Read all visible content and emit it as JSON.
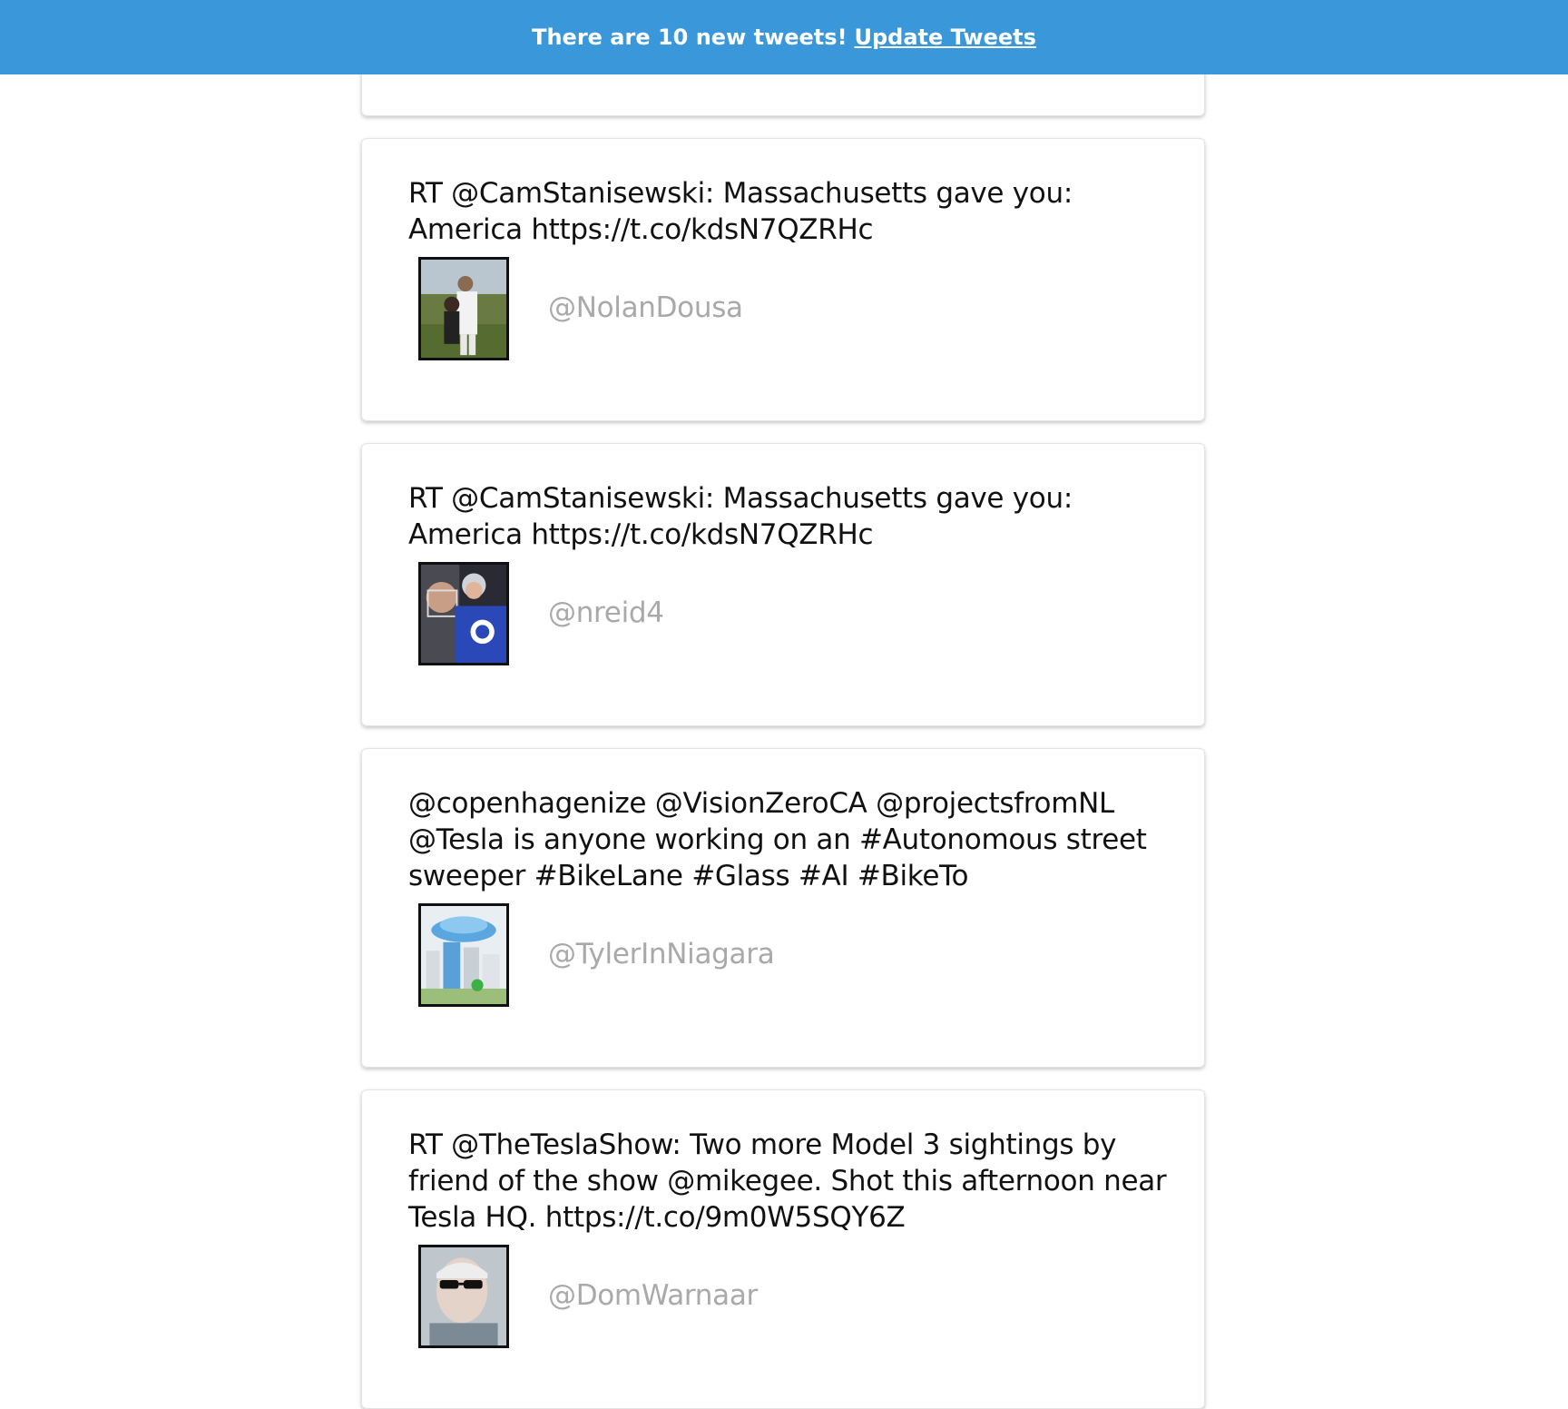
{
  "banner": {
    "message": "There are 10 new tweets!",
    "link_label": "Update Tweets",
    "background_color": "#3a97da"
  },
  "tweets": [
    {
      "text": "RT @CamStanisewski: Massachusetts gave you: America https://t.co/kdsN7QZRHc",
      "handle": "@NolanDousa",
      "avatar": "baseball-photo-avatar"
    },
    {
      "text": "RT @CamStanisewski: Massachusetts gave you: America https://t.co/kdsN7QZRHc",
      "handle": "@nreid4",
      "avatar": "hockey-selfie-avatar"
    },
    {
      "text": "@copenhagenize @VisionZeroCA @projectsfromNL @Tesla is anyone working on an #Autonomous street sweeper #BikeLane #Glass #AI #BikeTo",
      "handle": "@TylerInNiagara",
      "avatar": "city-cloud-avatar"
    },
    {
      "text": "RT @TheTeslaShow: Two more Model 3 sightings by friend of the show @mikegee. Shot this afternoon near Tesla HQ. https://t.co/9m0W5SQY6Z",
      "handle": "@DomWarnaar",
      "avatar": "sunglasses-selfie-avatar"
    }
  ]
}
